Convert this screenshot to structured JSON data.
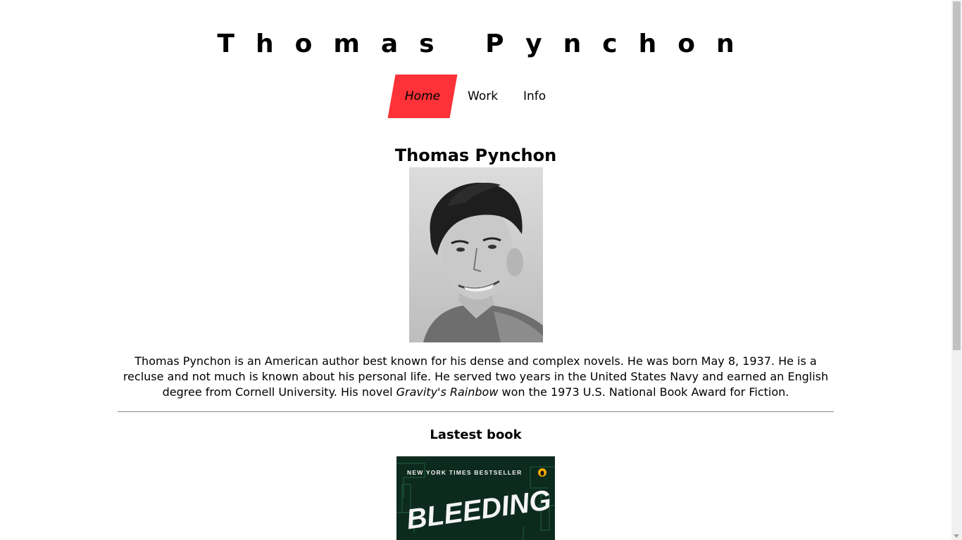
{
  "site": {
    "title": "Thomas Pynchon"
  },
  "nav": {
    "items": [
      {
        "label": "Home",
        "active": true
      },
      {
        "label": "Work",
        "active": false
      },
      {
        "label": "Info",
        "active": false
      }
    ],
    "active_color": "#fc3238"
  },
  "main": {
    "heading": "Thomas Pynchon",
    "bio_before": "Thomas Pynchon is an American author best known for his dense and complex novels. He was born May 8, 1937. He is a recluse and not much is known about his personal life. He served two years in the United States Navy and earned an English degree from Cornell University. His novel ",
    "bio_title": "Gravity's Rainbow",
    "bio_after": " won the 1973 U.S. National Book Award for Fiction."
  },
  "latest": {
    "heading": "Lastest book",
    "cover_banner": "NEW YORK TIMES BESTSELLER",
    "cover_title": "BLEEDING EDGE"
  }
}
